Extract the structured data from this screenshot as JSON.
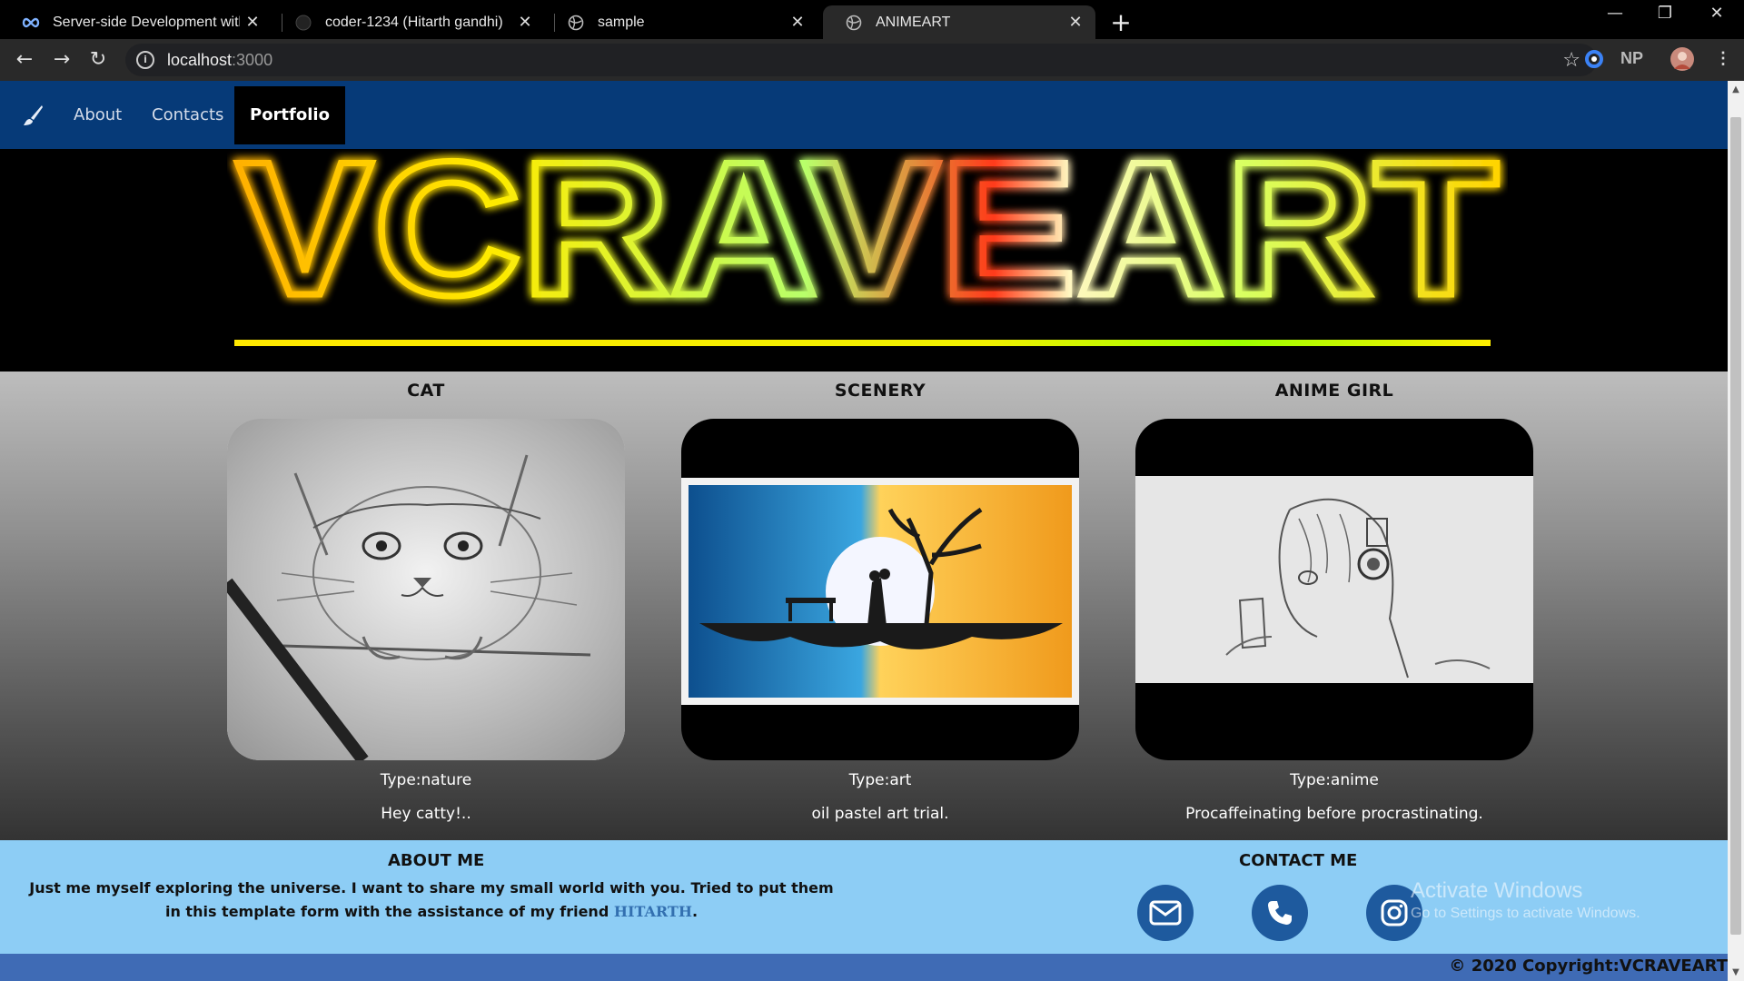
{
  "browser": {
    "tabs": [
      {
        "title": "Server-side Development with No",
        "active": false
      },
      {
        "title": "coder-1234 (Hitarth gandhi)",
        "active": false
      },
      {
        "title": "sample",
        "active": false
      },
      {
        "title": "ANIMEART",
        "active": true
      }
    ],
    "new_tab_label": "+",
    "url_host": "localhost",
    "url_port": ":3000",
    "ext_np_label": "NP"
  },
  "nav": {
    "items": [
      {
        "label": "About",
        "active": false
      },
      {
        "label": "Contacts",
        "active": false
      },
      {
        "label": "Portfolio",
        "active": true
      }
    ]
  },
  "banner": {
    "title": "VCRAVEART"
  },
  "gallery": [
    {
      "title": "CAT",
      "type": "Type:nature",
      "desc": "Hey catty!.."
    },
    {
      "title": "SCENERY",
      "type": "Type:art",
      "desc": "oil pastel art trial."
    },
    {
      "title": "ANIME GIRL",
      "type": "Type:anime",
      "desc": "Procaffeinating before procrastinating."
    }
  ],
  "footer": {
    "about_heading": "ABOUT ME",
    "about_text": "Just me myself exploring the universe. I want to share my small world with you. Tried to put them in this template form with the assistance of my friend",
    "friend_name": "HITARTH",
    "about_text_end": ".",
    "contact_heading": "CONTACT ME",
    "contact_icons": [
      "envelope-icon",
      "phone-icon",
      "instagram-icon"
    ],
    "watermark_title": "Activate Windows",
    "watermark_sub": "Go to Settings to activate Windows.",
    "copyright": "© 2020 Copyright:VCRAVEART"
  },
  "colors": {
    "nav_bg": "#063a78",
    "footer_bg": "#8dcdf5",
    "copy_bg": "#3f6bb5"
  }
}
